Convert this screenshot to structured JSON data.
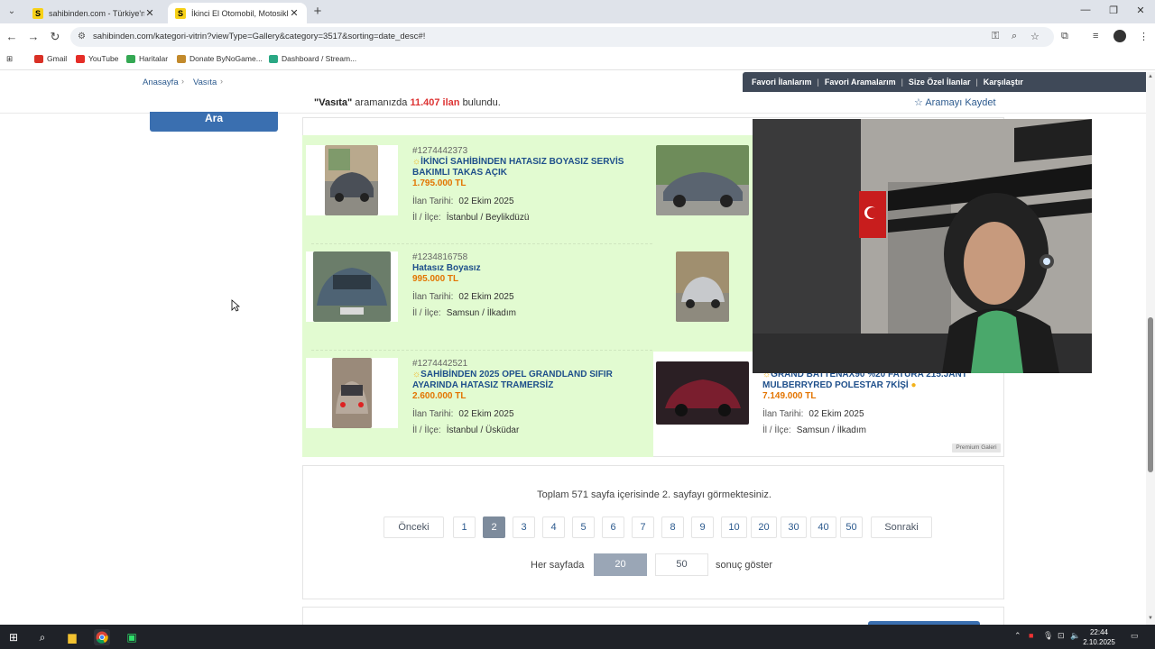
{
  "browser": {
    "tabs": [
      {
        "title": "sahibinden.com - Türkiye'nin O",
        "active": false
      },
      {
        "title": "İkinci El Otomobil, Motosiklet V",
        "active": true
      }
    ],
    "url": "sahibinden.com/kategori-vitrin?viewType=Gallery&category=3517&sorting=date_desc#!",
    "bookmarks": [
      "Gmail",
      "YouTube",
      "Haritalar",
      "Donate ByNoGame...",
      "Dashboard / Stream..."
    ]
  },
  "header": {
    "breadcrumbs": [
      "Anasayfa",
      "Vasıta"
    ],
    "user_links": [
      "Favori İlanlarım",
      "Favori Aramalarım",
      "Size Özel İlanlar",
      "Karşılaştır"
    ]
  },
  "results": {
    "query_quoted": "\"Vasıta\"",
    "text_mid": "aramanızda",
    "count": "11.407 ilan",
    "text_end": "bulundu.",
    "save_search": "Aramayı Kaydet"
  },
  "sidebar": {
    "search_button": "Ara"
  },
  "listings": [
    {
      "ad_no": "#1274442373",
      "title": "İKİNCİ SAHİBİNDEN HATASIZ BOYASIZ SERVİS BAKIMLI TAKAS AÇIK",
      "price": "1.795.000 TL",
      "date_label": "İlan Tarihi:",
      "date": "02 Ekim 2025",
      "loc_label": "İl / İlçe:",
      "location": "İstanbul / Beylikdüzü"
    },
    {
      "ad_no": "#1234816758",
      "title": "Hatasız Boyasız",
      "price": "995.000 TL",
      "date_label": "İlan Tarihi:",
      "date": "02 Ekim 2025",
      "loc_label": "İl / İlçe:",
      "location": "Samsun / İlkadım"
    },
    {
      "ad_no": "#1274442521",
      "title": "SAHİBİNDEN 2025 OPEL GRANDLAND SIFIR AYARINDA HATASIZ TRAMERSİZ",
      "price": "2.600.000 TL",
      "date_label": "İlan Tarihi:",
      "date": "02 Ekim 2025",
      "loc_label": "İl / İlçe:",
      "location": "İstanbul / Üsküdar"
    },
    {
      "ad_no": "",
      "title": "GRAND BATTENAX90 %20 FATURA 215.JANT MULBERRYRED POLESTAR 7KİŞİ",
      "price": "7.149.000 TL",
      "date_label": "İlan Tarihi:",
      "date": "02 Ekim 2025",
      "loc_label": "İl / İlçe:",
      "location": "Samsun / İlkadım",
      "badge": "Premium Galeri"
    }
  ],
  "pagination": {
    "summary": "Toplam 571 sayfa içerisinde 2. sayfayı görmektesiniz.",
    "prev": "Önceki",
    "next": "Sonraki",
    "pages": [
      "1",
      "2",
      "3",
      "4",
      "5",
      "6",
      "7",
      "8",
      "9",
      "10",
      "20",
      "30",
      "40",
      "50"
    ],
    "current": "2",
    "per_page_label": "Her sayfada",
    "per_page_options": [
      "20",
      "50"
    ],
    "per_page_current": "20",
    "per_page_suffix": "sonuç göster"
  },
  "taskbar": {
    "time": "22:44",
    "date": "2.10.2025"
  },
  "colors": {
    "link": "#1e4f8b",
    "price": "#e37400",
    "highlight_bg": "#e2fbd1",
    "userbar": "#3f4958",
    "count": "#dd3333"
  },
  "icons": [
    "windows-start-icon",
    "search-icon",
    "file-explorer-icon",
    "chrome-icon",
    "app-icon"
  ]
}
